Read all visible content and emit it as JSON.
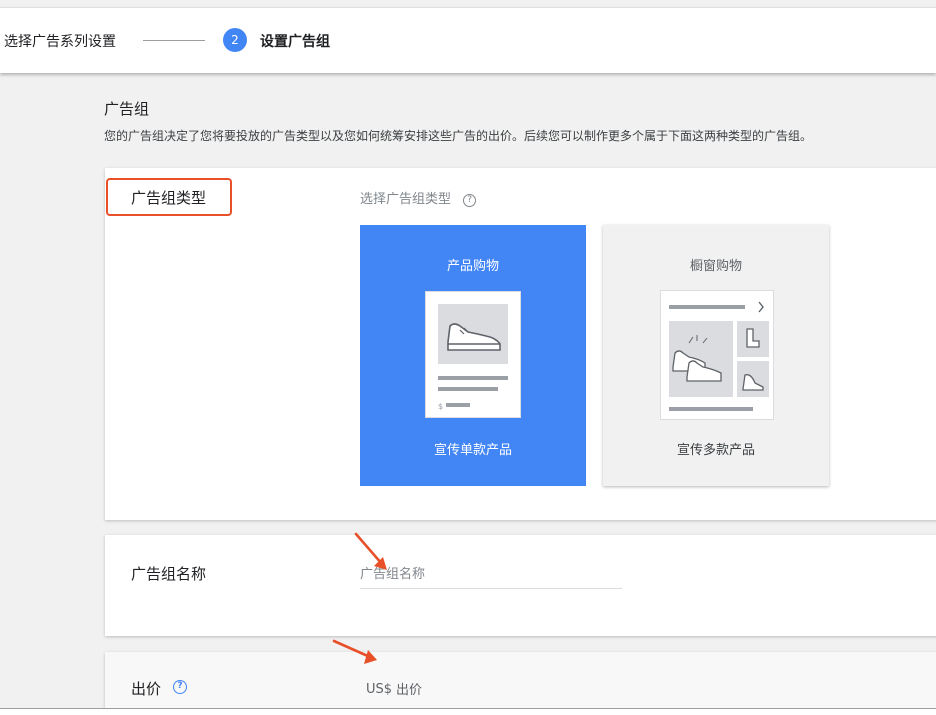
{
  "stepper": {
    "step1_label": "选择广告系列设置",
    "step2_number": "2",
    "step2_label": "设置广告组"
  },
  "ad_group": {
    "title": "广告组",
    "description": "您的广告组决定了您将要投放的广告类型以及您如何统筹安排这些广告的出价。后续您可以制作更多个属于下面这两种类型的广告组。"
  },
  "type_section": {
    "label": "广告组类型",
    "hint": "选择广告组类型",
    "help_icon": "help-icon",
    "options": [
      {
        "title": "产品购物",
        "subtitle": "宣传单款产品",
        "selected": true,
        "icon": "single-product-illustration"
      },
      {
        "title": "橱窗购物",
        "subtitle": "宣传多款产品",
        "selected": false,
        "icon": "showcase-illustration"
      }
    ]
  },
  "name_section": {
    "label": "广告组名称",
    "placeholder": "广告组名称",
    "value": ""
  },
  "bid_section": {
    "label": "出价",
    "help_icon": "help-icon",
    "prefix": "US$",
    "placeholder": "出价",
    "value": ""
  },
  "colors": {
    "accent": "#4285f4",
    "highlight_box": "#e8502a",
    "annotation_arrow": "#e8502a"
  }
}
